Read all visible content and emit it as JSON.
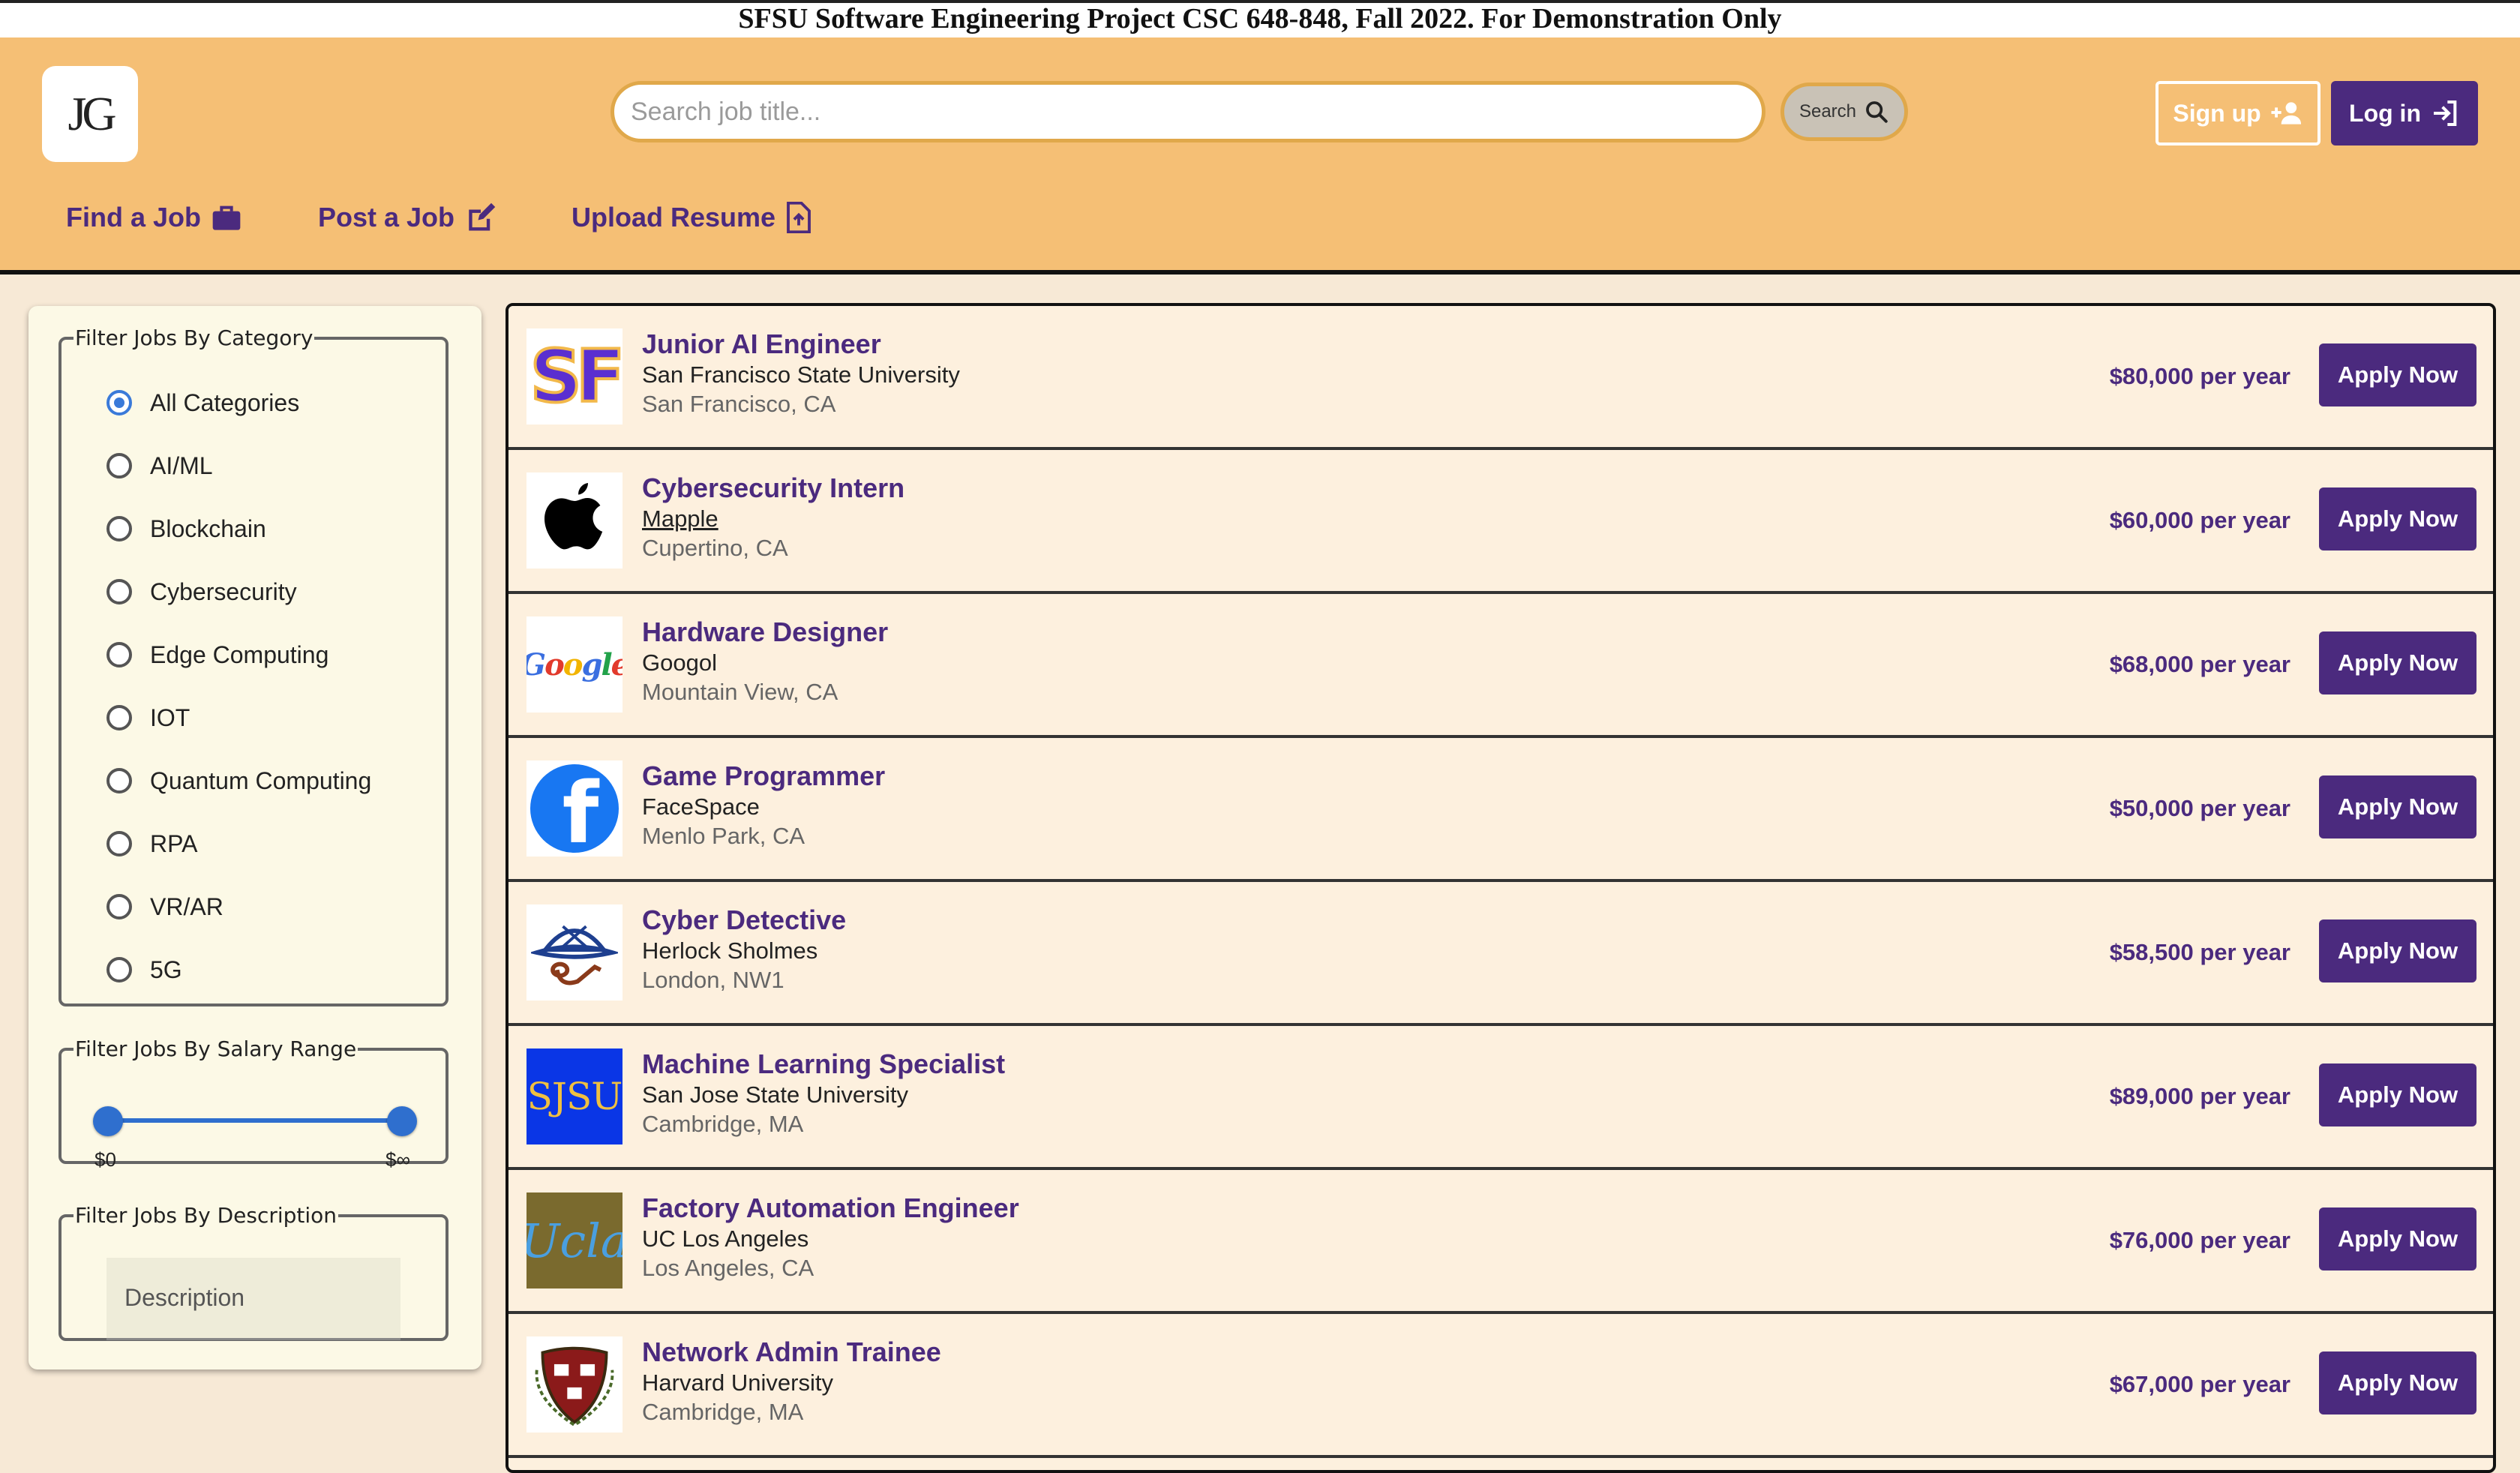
{
  "banner": "SFSU Software Engineering Project CSC 648-848, Fall 2022. For Demonstration Only",
  "header": {
    "logo_text": "JG",
    "search_placeholder": "Search job title...",
    "search_button": "Search",
    "signup_label": "Sign up",
    "login_label": "Log in",
    "nav": [
      {
        "label": "Find a Job",
        "icon": "briefcase-icon"
      },
      {
        "label": "Post a Job",
        "icon": "edit-icon"
      },
      {
        "label": "Upload Resume",
        "icon": "file-upload-icon"
      }
    ],
    "colors": {
      "header_bg": "#f5bf75",
      "accent": "#4b2a7e"
    }
  },
  "filters": {
    "category_legend": "Filter Jobs By Category",
    "categories": [
      "All Categories",
      "AI/ML",
      "Blockchain",
      "Cybersecurity",
      "Edge Computing",
      "IOT",
      "Quantum Computing",
      "RPA",
      "VR/AR",
      "5G"
    ],
    "selected_category": "All Categories",
    "salary_legend": "Filter Jobs By Salary Range",
    "salary_min_label": "$0",
    "salary_max_label": "$∞",
    "description_legend": "Filter Jobs By Description",
    "description_placeholder": "Description"
  },
  "jobs": [
    {
      "title": "Junior AI Engineer",
      "company": "San Francisco State University",
      "location": "San Francisco, CA",
      "salary": "$80,000 per year",
      "apply": "Apply Now",
      "logo": "SF"
    },
    {
      "title": "Cybersecurity Intern",
      "company": "Mapple",
      "location": "Cupertino, CA",
      "salary": "$60,000 per year",
      "apply": "Apply Now",
      "logo": "apple-logo"
    },
    {
      "title": "Hardware Designer",
      "company": "Googol",
      "location": "Mountain View, CA",
      "salary": "$68,000 per year",
      "apply": "Apply Now",
      "logo": "Google"
    },
    {
      "title": "Game Programmer",
      "company": "FaceSpace",
      "location": "Menlo Park, CA",
      "salary": "$50,000 per year",
      "apply": "Apply Now",
      "logo": "f"
    },
    {
      "title": "Cyber Detective",
      "company": "Herlock Sholmes",
      "location": "London, NW1",
      "salary": "$58,500 per year",
      "apply": "Apply Now",
      "logo": "detective-hat-logo"
    },
    {
      "title": "Machine Learning Specialist",
      "company": "San Jose State University",
      "location": "Cambridge, MA",
      "salary": "$89,000 per year",
      "apply": "Apply Now",
      "logo": "SJSU"
    },
    {
      "title": "Factory Automation Engineer",
      "company": "UC Los Angeles",
      "location": "Los Angeles, CA",
      "salary": "$76,000 per year",
      "apply": "Apply Now",
      "logo": "Ucla"
    },
    {
      "title": "Network Admin Trainee",
      "company": "Harvard University",
      "location": "Cambridge, MA",
      "salary": "$67,000 per year",
      "apply": "Apply Now",
      "logo": "harvard-shield-logo"
    }
  ]
}
